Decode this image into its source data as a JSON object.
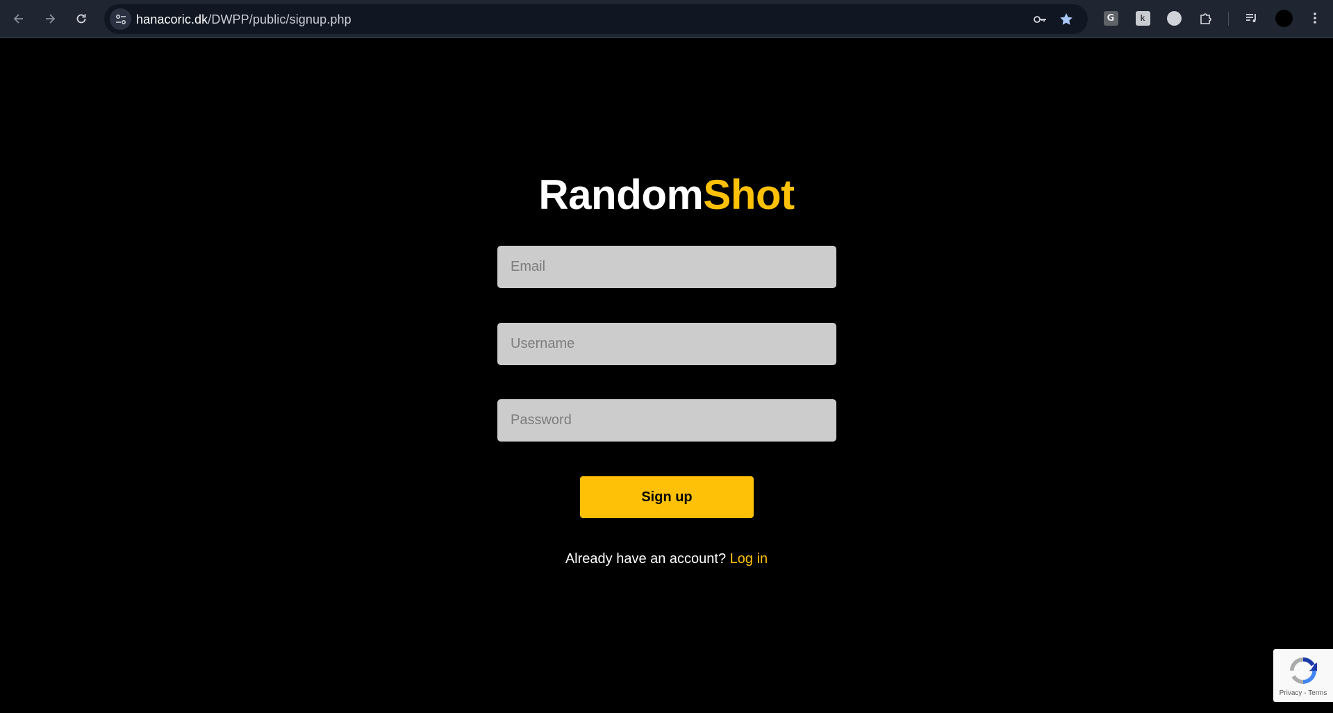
{
  "browser": {
    "url_host": "hanacoric.dk",
    "url_path": "/DWPP/public/signup.php"
  },
  "extensions": {
    "ext1_label": "G",
    "ext2_label": "k"
  },
  "logo": {
    "part1": "Random",
    "part2": "Shot"
  },
  "form": {
    "email_placeholder": "Email",
    "username_placeholder": "Username",
    "password_placeholder": "Password",
    "submit_label": "Sign up"
  },
  "footer": {
    "prompt": "Already have an account?",
    "login_link": "Log in"
  },
  "recaptcha": {
    "privacy": "Privacy",
    "separator": " - ",
    "terms": "Terms"
  },
  "colors": {
    "accent": "#ffc107",
    "background": "#000000",
    "input_bg": "#cccccc"
  }
}
